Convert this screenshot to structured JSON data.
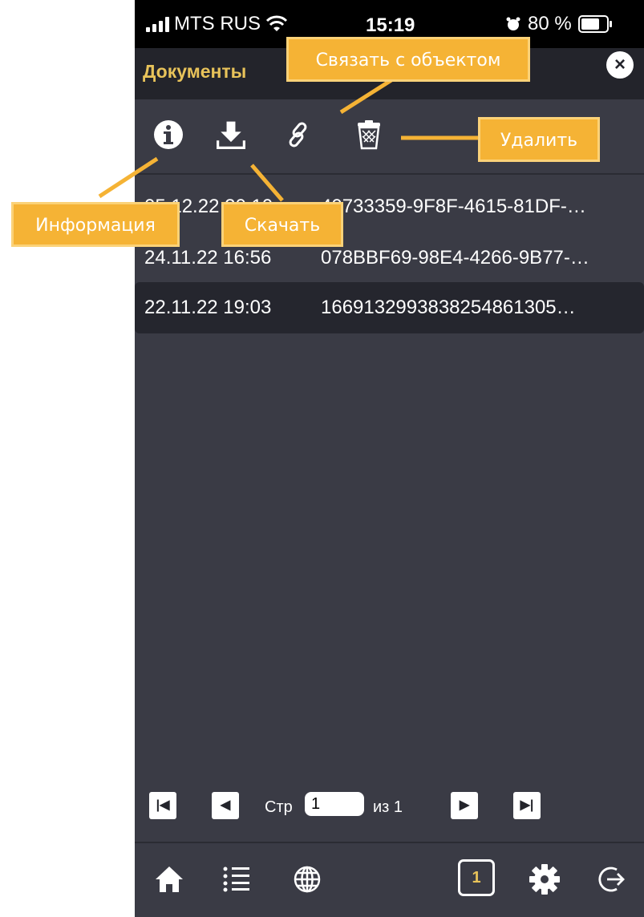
{
  "statusbar": {
    "carrier": "MTS RUS",
    "time": "15:19",
    "battery": "80 %"
  },
  "header": {
    "title": "Документы"
  },
  "documents": [
    {
      "date": "05.12.22 20:10",
      "name": "40733359-9F8F-4615-81DF-…"
    },
    {
      "date": "24.11.22 16:56",
      "name": "078BBF69-98E4-4266-9B77-…"
    },
    {
      "date": "22.11.22 19:03",
      "name": "1669132993838254861305…"
    }
  ],
  "pager": {
    "page_label": "Стр",
    "page_value": "1",
    "of_label": "из 1"
  },
  "tab_count": "1",
  "callouts": {
    "link": "Связать с объектом",
    "delete": "Удалить",
    "info": "Информация",
    "download": "Скачать"
  },
  "icons": {
    "info": "info-icon",
    "download": "download-icon",
    "link": "link-icon",
    "delete": "trash-icon",
    "home": "home-icon",
    "list": "list-icon",
    "globe": "globe-icon",
    "settings": "gear-icon",
    "logout": "logout-icon"
  },
  "colors": {
    "accent": "#e8c35a",
    "callout": "#f5b335",
    "background": "#3a3b45",
    "header": "#23242b"
  }
}
